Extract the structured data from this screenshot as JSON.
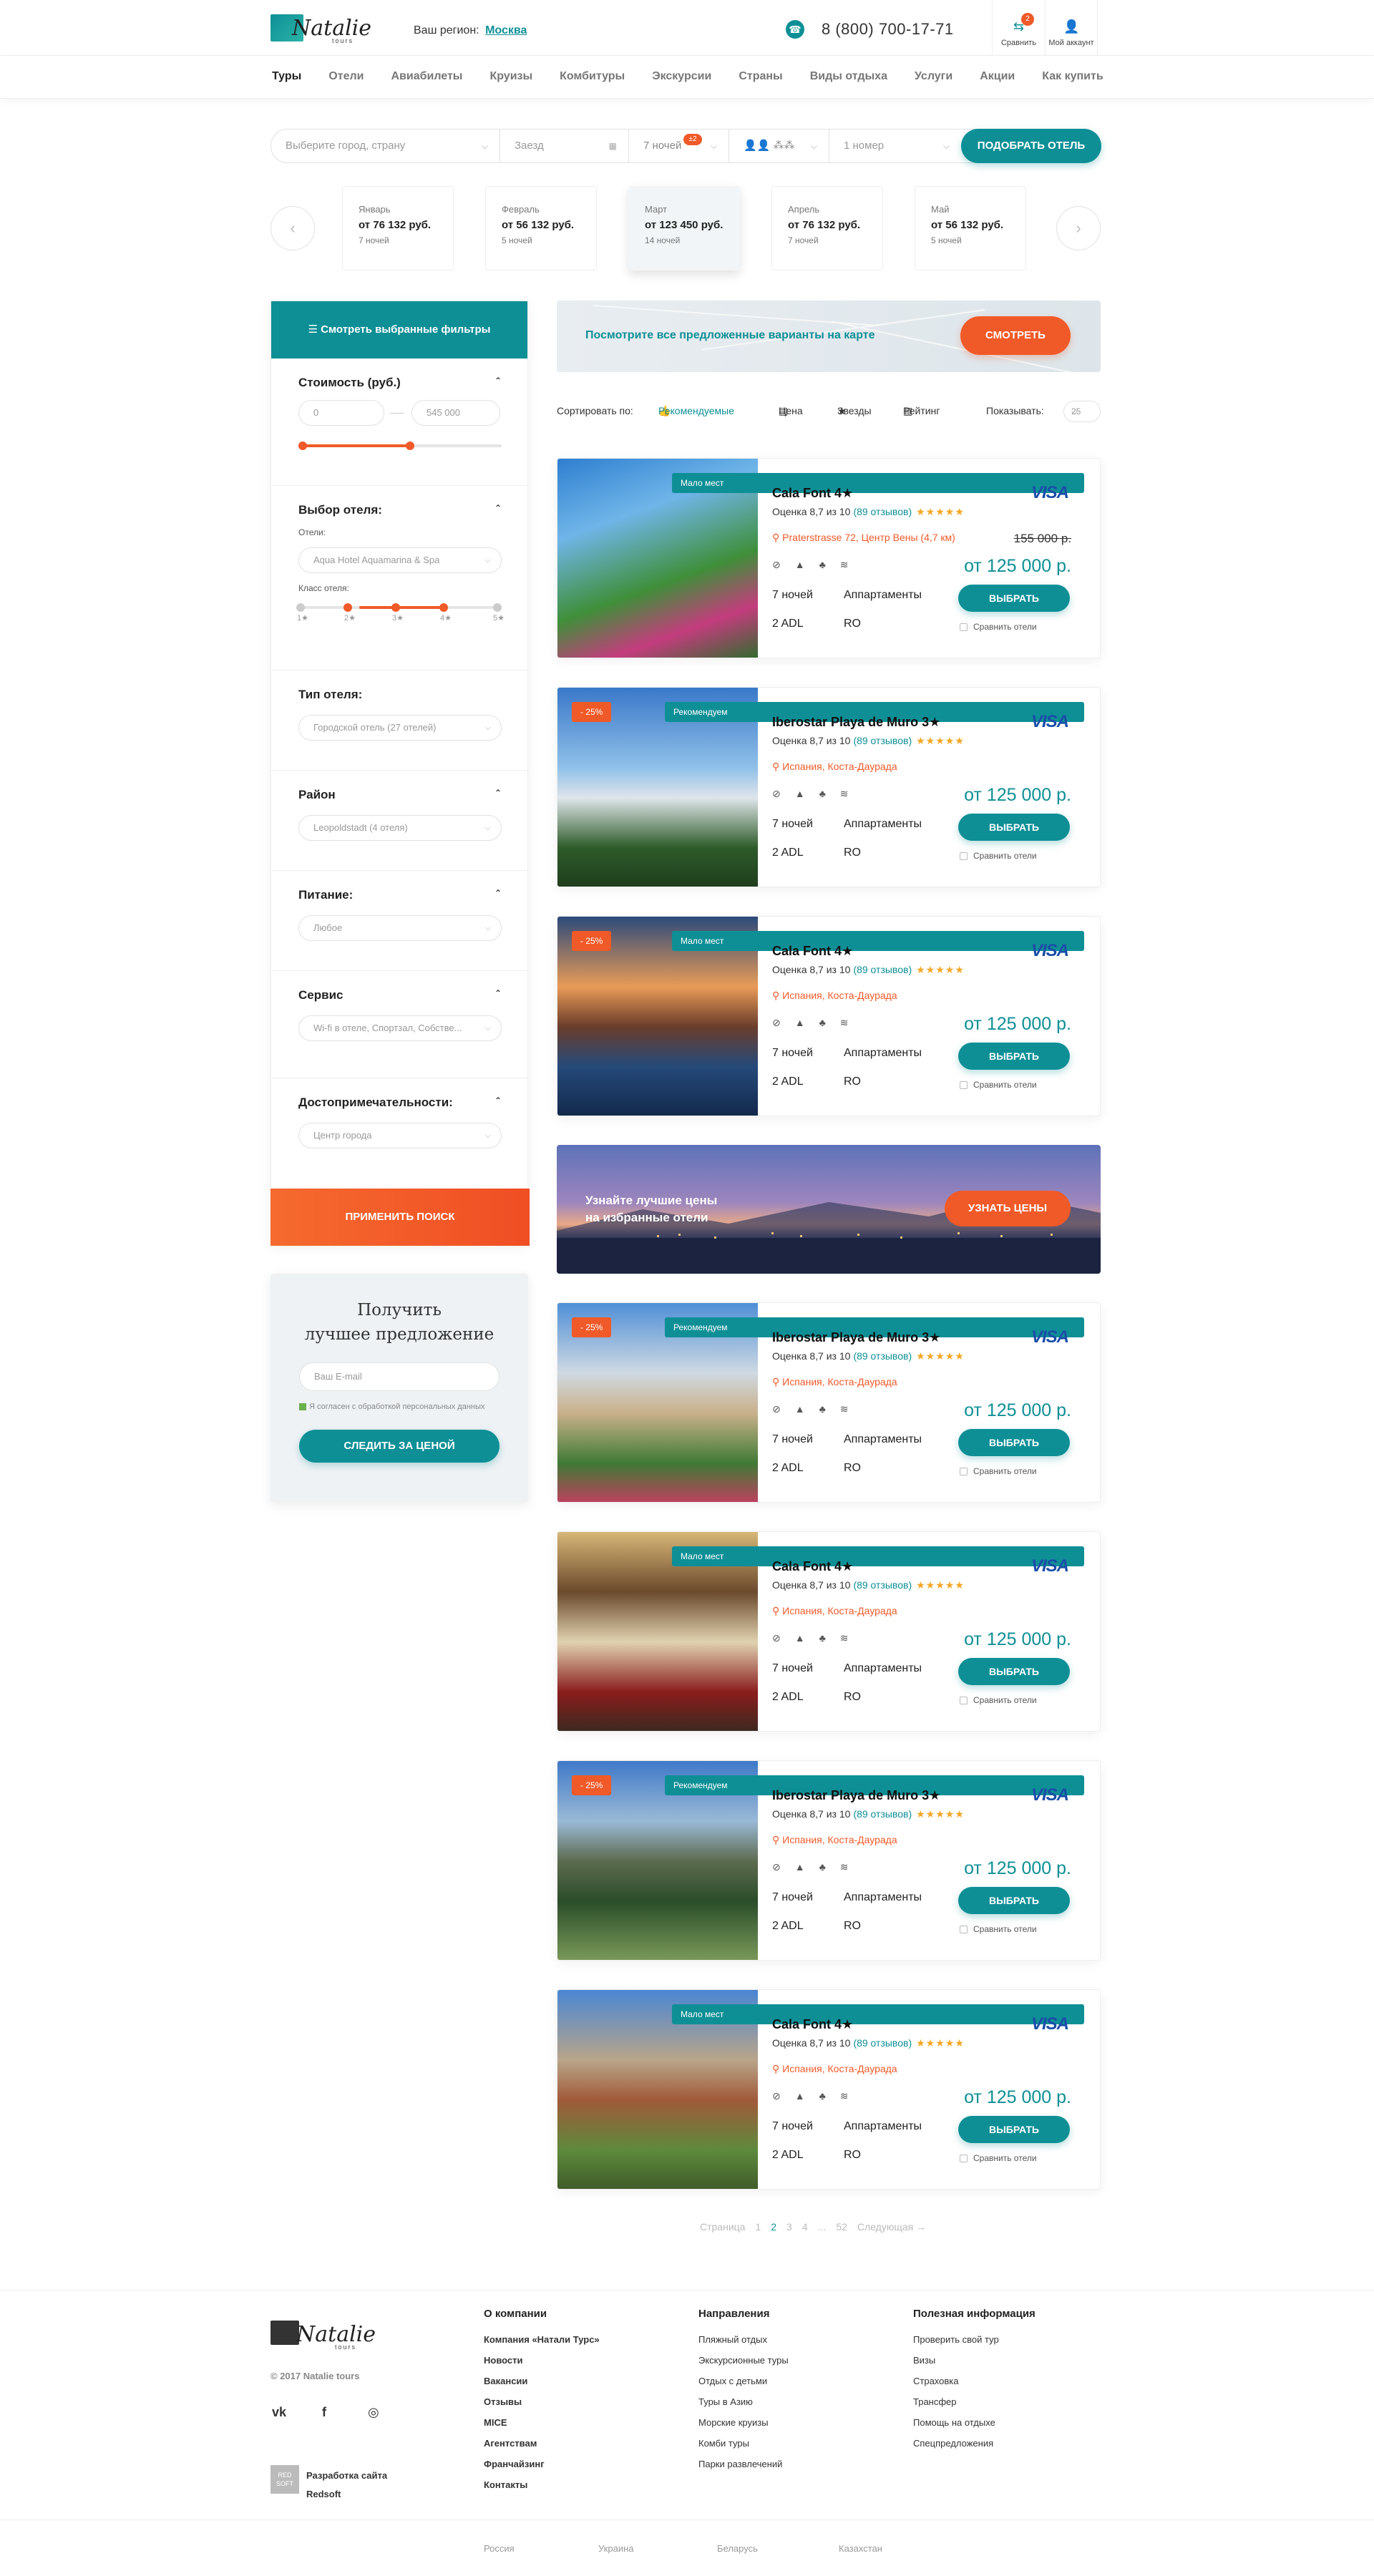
{
  "header": {
    "region_label": "Ваш регион:",
    "region_value": "Москва",
    "phone": "8 (800) 700-17-71",
    "compare_label": "Сравнить",
    "compare_count": "2",
    "account_label": "Мой аккаунт",
    "logo_text": "Natalie",
    "logo_sub": "tours"
  },
  "nav": [
    "Туры",
    "Отели",
    "Авиабилеты",
    "Круизы",
    "Комбитуры",
    "Экскурсии",
    "Страны",
    "Виды отдыха",
    "Услуги",
    "Акции",
    "Как купить"
  ],
  "search": {
    "destination_placeholder": "Выберите город, страну",
    "date_placeholder": "Заезд",
    "nights": "7 ночей",
    "nights_badge": "±2",
    "rooms": "1 номер",
    "button": "ПОДОБРАТЬ ОТЕЛЬ"
  },
  "months": [
    {
      "name": "Январь",
      "price": "от 76 132 руб.",
      "nights": "7 ночей"
    },
    {
      "name": "Февраль",
      "price": "от 56 132 руб.",
      "nights": "5 ночей"
    },
    {
      "name": "Март",
      "price": "от 123 450 руб.",
      "nights": "14 ночей"
    },
    {
      "name": "Апрель",
      "price": "от 76 132 руб.",
      "nights": "7 ночей"
    },
    {
      "name": "Май",
      "price": "от 56 132 руб.",
      "nights": "5 ночей"
    }
  ],
  "sidebar": {
    "head": "Смотреть выбранные фильтры",
    "cost_title": "Стоимость (руб.)",
    "cost_from": "0",
    "cost_to": "545 000",
    "cost_level": 0.55,
    "hotel_title": "Выбор отеля:",
    "hotels_label": "Отели:",
    "hotel_value": "Aqua Hotel Aquamarina & Spa",
    "class_label": "Класс отеля:",
    "class_stars": [
      "1★",
      "2★",
      "3★",
      "4★",
      "5★"
    ],
    "type_title": "Тип отеля:",
    "type_value": "Городской отель (27 отелей)",
    "district_title": "Район",
    "district_value": "Leopoldstadt (4 отеля)",
    "food_title": "Питание:",
    "food_value": "Любое",
    "service_title": "Сервис",
    "service_value": "Wi-fi в отеле, Спортзал, Собстве...",
    "sights_title": "Достопримечательности:",
    "sights_value": "Центр города",
    "apply": "ПРИМЕНИТЬ ПОИСК"
  },
  "offer": {
    "title_line1": "Получить",
    "title_line2": "лучшее предложение",
    "email_placeholder": "Ваш E-mail",
    "consent": "Я согласен с обработкой персональных данных",
    "button": "СЛЕДИТЬ ЗА ЦЕНОЙ"
  },
  "map": {
    "text": "Посмотрите все предложенные варианты на карте",
    "button": "СМОТРЕТЬ"
  },
  "sort": {
    "label": "Сортировать по:",
    "recommended": "Рекомендуемые",
    "price": "Цена",
    "stars": "Звезды",
    "rating": "Рейтинг",
    "show_label": "Показывать:",
    "show_value": "25"
  },
  "hotels": [
    {
      "tag": "Мало мест",
      "discount": "",
      "name": "Cala Font 4★",
      "rating": "Оценка 8,7 из 10",
      "reviews": "(89 отзывов)",
      "stars": "★★★★★",
      "address": "Praterstrasse 72, Центр Вены (4,7 км)",
      "old_price": "155 000 р.",
      "price": "от 125 000 р.",
      "nights": "7 ночей",
      "room": "Аппартаменты",
      "adl": "2 ADL",
      "meal": "RO"
    },
    {
      "tag": "Рекомендуем",
      "discount": "- 25%",
      "name": "Iberostar Playa de Muro 3★",
      "rating": "Оценка 8,7 из 10",
      "reviews": "(89 отзывов)",
      "stars": "★★★★★",
      "address": "Испания, Коста-Даурада",
      "old_price": "",
      "price": "от 125 000 р.",
      "nights": "7 ночей",
      "room": "Аппартаменты",
      "adl": "2 ADL",
      "meal": "RO"
    },
    {
      "tag": "Мало мест",
      "discount": "- 25%",
      "name": "Cala Font 4★",
      "rating": "Оценка 8,7 из 10",
      "reviews": "(89 отзывов)",
      "stars": "★★★★★",
      "address": "Испания, Коста-Даурада",
      "old_price": "",
      "price": "от 125 000 р.",
      "nights": "7 ночей",
      "room": "Аппартаменты",
      "adl": "2 ADL",
      "meal": "RO"
    },
    {
      "tag": "Рекомендуем",
      "discount": "- 25%",
      "name": "Iberostar Playa de Muro 3★",
      "rating": "Оценка 8,7 из 10",
      "reviews": "(89 отзывов)",
      "stars": "★★★★★",
      "address": "Испания, Коста-Даурада",
      "old_price": "",
      "price": "от 125 000 р.",
      "nights": "7 ночей",
      "room": "Аппартаменты",
      "adl": "2 ADL",
      "meal": "RO"
    },
    {
      "tag": "Мало мест",
      "discount": "",
      "name": "Cala Font 4★",
      "rating": "Оценка 8,7 из 10",
      "reviews": "(89 отзывов)",
      "stars": "★★★★★",
      "address": "Испания, Коста-Даурада",
      "old_price": "",
      "price": "от 125 000 р.",
      "nights": "7 ночей",
      "room": "Аппартаменты",
      "adl": "2 ADL",
      "meal": "RO"
    },
    {
      "tag": "Рекомендуем",
      "discount": "- 25%",
      "name": "Iberostar Playa de Muro 3★",
      "rating": "Оценка 8,7 из 10",
      "reviews": "(89 отзывов)",
      "stars": "★★★★★",
      "address": "Испания, Коста-Даурада",
      "old_price": "",
      "price": "от 125 000 р.",
      "nights": "7 ночей",
      "room": "Аппартаменты",
      "adl": "2 ADL",
      "meal": "RO"
    },
    {
      "tag": "Мало мест",
      "discount": "",
      "name": "Cala Font 4★",
      "rating": "Оценка 8,7 из 10",
      "reviews": "(89 отзывов)",
      "stars": "★★★★★",
      "address": "Испания, Коста-Даурада",
      "old_price": "",
      "price": "от 125 000 р.",
      "nights": "7 ночей",
      "room": "Аппартаменты",
      "adl": "2 ADL",
      "meal": "RO"
    }
  ],
  "card_ui": {
    "visa": "VISA",
    "choose": "ВЫБРАТЬ",
    "compare": "Сравнить отели"
  },
  "promo": {
    "line1": "Узнайте лучшие цены",
    "line2": "на избранные отели",
    "button": "УЗНАТЬ ЦЕНЫ"
  },
  "pager": {
    "label": "Страница",
    "pages": [
      "1",
      "2",
      "3",
      "4",
      "...",
      "52"
    ],
    "current": "2",
    "next": "Следующая →"
  },
  "footer": {
    "copyright": "© 2017 Natalie tours",
    "social": [
      "vk-icon",
      "facebook-icon",
      "instagram-icon"
    ],
    "developer_line1": "Разработка сайта",
    "developer_line2": "Redsoft",
    "developer_logo": "RED SOFT",
    "col1_title": "О компании",
    "col1": [
      "Компания «Натали Турс»",
      "Новости",
      "Вакансии",
      "Отзывы",
      "MICE",
      "Агентствам",
      "Франчайзинг",
      "Контакты"
    ],
    "col2_title": "Направления",
    "col2": [
      "Пляжный отдых",
      "Экскурсионные туры",
      "Отдых с детьми",
      "Туры в Азию",
      "Морские круизы",
      "Комби туры",
      "Парки развлечений"
    ],
    "col3_title": "Полезная информация",
    "col3": [
      "Проверить свой тур",
      "Визы",
      "Страховка",
      "Трансфер",
      "Помощь на отдыхе",
      "Спецпредложения"
    ],
    "countries": [
      "Россия",
      "Украина",
      "Беларусь",
      "Казахстан"
    ]
  }
}
